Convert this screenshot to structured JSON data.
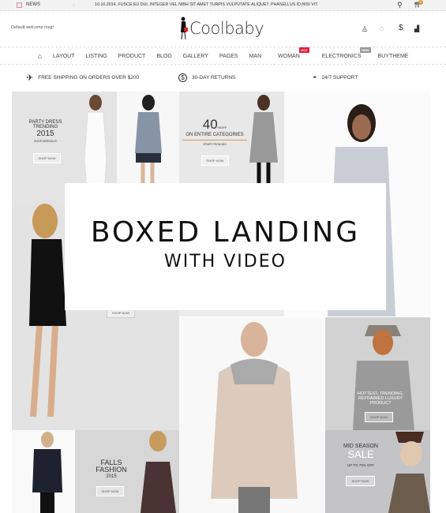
{
  "topbar": {
    "news_label": "NEWS",
    "ticker": "10.10.2014. FUSCE EU DUI. INTEGER VEL NIBH SIT AMET TURPIS VULPUTATE ALIQUET. PHASELLUS ID NISI VIT.",
    "cart_count": "0"
  },
  "header": {
    "welcome": "Default welcome msg!",
    "logo": "Coolbaby"
  },
  "nav": {
    "items": [
      "LAYOUT",
      "LISTING",
      "PRODUCT",
      "BLOG",
      "GALLERY",
      "PAGES",
      "MAN",
      "WOMAN",
      "ELECTRONICS",
      "BUYTHEME"
    ],
    "hot_badge": "HOT",
    "new_badge": "NEW"
  },
  "features": {
    "shipping": "FREE SHIPPING ON ORDERS OVER $200",
    "returns": "30-DAY RETURNS",
    "support": "24/7 SUPPORT"
  },
  "banners": {
    "party": {
      "l1": "PARTY DRESS",
      "l2": "TRENDING",
      "l3": "2015",
      "sub": "SHOP ARRIVALS!",
      "btn": "SHOP NOW"
    },
    "off": {
      "big": "40",
      "pct": "%OFF",
      "l2": "ON ENTIRE CATEGORIES",
      "sub": "START FROM $10",
      "btn": "SHOP NOW"
    },
    "black": {
      "btn": "SHOP NOW"
    },
    "hottest": {
      "l1": "HOTTEST, TRENDING,",
      "l2": "REFRAIMED LUXURY",
      "l3": "PRODUCT",
      "btn": "SHOP NOW"
    },
    "falls": {
      "l1": "FALLS",
      "l2": "FASHION",
      "l3": "2015",
      "btn": "SHOP NOW"
    },
    "sale": {
      "l1": "MID SEASON",
      "l2": "SALE",
      "sub": "UP TO 70% OFF",
      "btn": "SHOP NOW"
    }
  },
  "overlay": {
    "title": "BOXED LANDING",
    "subtitle": "WITH VIDEO"
  },
  "colors": {
    "hot": "#e8173d",
    "new": "#999999"
  }
}
